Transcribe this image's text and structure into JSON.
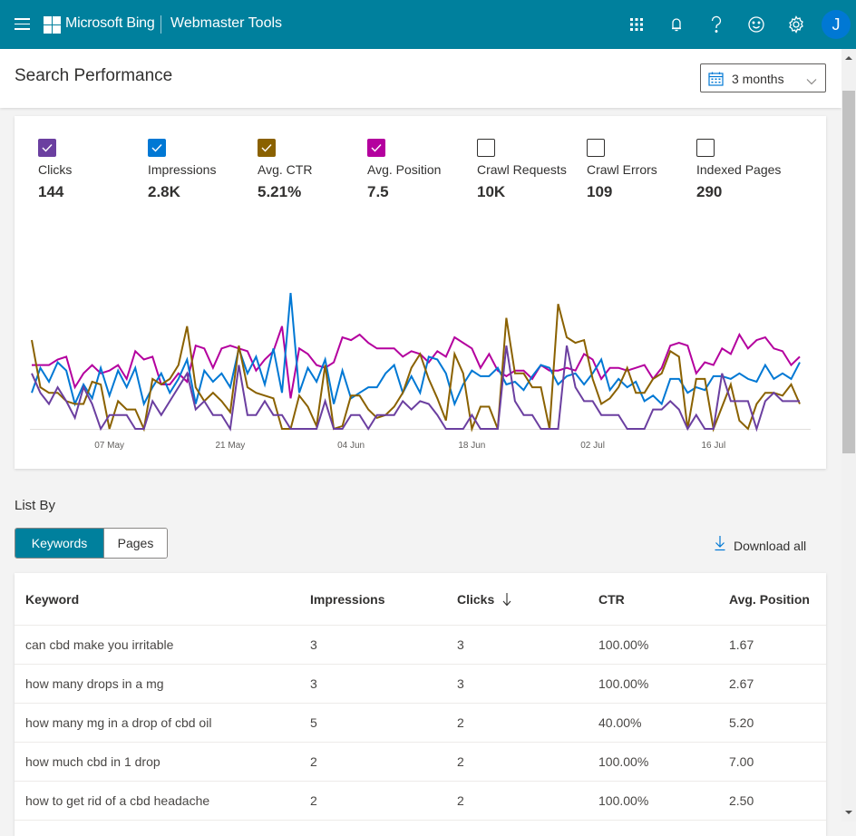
{
  "topbar": {
    "brand": "Microsoft Bing",
    "product": "Webmaster Tools",
    "avatar_initial": "J",
    "icons": [
      "menu-icon",
      "microsoft-logo-icon",
      "app-launcher-icon",
      "bell-icon",
      "help-icon",
      "feedback-smiley-icon",
      "settings-gear-icon"
    ],
    "bg_color": "#00809d"
  },
  "header": {
    "title": "Search Performance",
    "date_range": "3 months"
  },
  "metrics": [
    {
      "label": "Clicks",
      "value": "144",
      "checked": true,
      "color": "#6b3fa0"
    },
    {
      "label": "Impressions",
      "value": "2.8K",
      "checked": true,
      "color": "#0078d4"
    },
    {
      "label": "Avg. CTR",
      "value": "5.21%",
      "checked": true,
      "color": "#8a6100"
    },
    {
      "label": "Avg. Position",
      "value": "7.5",
      "checked": true,
      "color": "#b4009e"
    },
    {
      "label": "Crawl Requests",
      "value": "10K",
      "checked": false,
      "color": "#323130"
    },
    {
      "label": "Crawl Errors",
      "value": "109",
      "checked": false,
      "color": "#323130"
    },
    {
      "label": "Indexed Pages",
      "value": "290",
      "checked": false,
      "color": "#323130"
    }
  ],
  "chart_data": {
    "type": "line",
    "title": "",
    "xlabel": "",
    "ylabel": "",
    "x_start": "28 Apr",
    "x_end": "26 Jul",
    "x_tick_labels": [
      "07 May",
      "21 May",
      "04 Jun",
      "18 Jun",
      "02 Jul",
      "16 Jul"
    ],
    "x_tick_indices": [
      9,
      23,
      37,
      51,
      65,
      79
    ],
    "ylim": [
      0,
      100
    ],
    "y_units": "normalized (each series scaled independently, no y-axis shown)",
    "grid": false,
    "legend": "none (metric checkboxes above)",
    "series": [
      {
        "name": "Avg. Position",
        "color": "#b4009e",
        "values": [
          46,
          46,
          46,
          50,
          52,
          30,
          40,
          46,
          40,
          42,
          46,
          36,
          56,
          50,
          52,
          32,
          32,
          40,
          34,
          60,
          58,
          44,
          58,
          60,
          58,
          56,
          42,
          50,
          56,
          74,
          22,
          58,
          54,
          46,
          44,
          48,
          66,
          64,
          68,
          62,
          58,
          58,
          58,
          52,
          56,
          54,
          48,
          56,
          52,
          66,
          62,
          58,
          44,
          54,
          42,
          38,
          42,
          42,
          36,
          46,
          42,
          42,
          44,
          42,
          54,
          50,
          36,
          44,
          44,
          42,
          44,
          46,
          36,
          44,
          60,
          62,
          60,
          40,
          48,
          46,
          58,
          54,
          68,
          58,
          64,
          66,
          58,
          56,
          46,
          52
        ]
      },
      {
        "name": "Impressions",
        "color": "#0078d4",
        "values": [
          26,
          44,
          34,
          48,
          42,
          18,
          32,
          22,
          44,
          24,
          42,
          30,
          44,
          18,
          30,
          40,
          26,
          36,
          50,
          18,
          42,
          34,
          40,
          30,
          58,
          40,
          52,
          32,
          58,
          26,
          98,
          26,
          44,
          34,
          50,
          18,
          42,
          22,
          26,
          30,
          30,
          40,
          46,
          26,
          38,
          26,
          52,
          50,
          40,
          18,
          32,
          42,
          38,
          38,
          44,
          32,
          34,
          28,
          38,
          46,
          44,
          32,
          38,
          40,
          32,
          40,
          50,
          28,
          36,
          30,
          34,
          20,
          24,
          18,
          36,
          36,
          26,
          30,
          28,
          38,
          38,
          36,
          40,
          36,
          34,
          46,
          36,
          40,
          36,
          48
        ]
      },
      {
        "name": "Avg. CTR",
        "color": "#8a6100",
        "values": [
          64,
          30,
          26,
          26,
          20,
          18,
          18,
          34,
          32,
          0,
          20,
          14,
          14,
          0,
          36,
          32,
          36,
          46,
          74,
          30,
          20,
          26,
          20,
          12,
          60,
          30,
          26,
          24,
          22,
          0,
          0,
          24,
          16,
          2,
          46,
          0,
          2,
          24,
          24,
          14,
          8,
          10,
          16,
          26,
          44,
          54,
          36,
          22,
          6,
          54,
          40,
          0,
          16,
          16,
          0,
          80,
          40,
          40,
          30,
          30,
          0,
          90,
          66,
          62,
          64,
          36,
          18,
          22,
          30,
          44,
          26,
          26,
          36,
          40,
          56,
          52,
          0,
          36,
          36,
          0,
          16,
          32,
          6,
          0,
          18,
          26,
          26,
          24,
          32,
          18
        ]
      },
      {
        "name": "Clicks",
        "color": "#6b3fa0",
        "values": [
          40,
          26,
          18,
          30,
          20,
          8,
          30,
          18,
          0,
          10,
          10,
          10,
          0,
          0,
          20,
          10,
          20,
          30,
          40,
          14,
          20,
          10,
          10,
          0,
          46,
          10,
          10,
          20,
          10,
          10,
          0,
          0,
          0,
          0,
          20,
          0,
          0,
          10,
          10,
          0,
          10,
          10,
          10,
          20,
          14,
          20,
          18,
          10,
          0,
          0,
          0,
          10,
          0,
          0,
          0,
          60,
          20,
          10,
          10,
          0,
          0,
          0,
          60,
          30,
          20,
          20,
          10,
          10,
          10,
          0,
          0,
          0,
          14,
          14,
          20,
          14,
          0,
          10,
          0,
          0,
          40,
          20,
          20,
          20,
          0,
          20,
          26,
          20,
          20,
          20
        ]
      }
    ]
  },
  "list": {
    "label": "List By",
    "tabs": [
      {
        "label": "Keywords",
        "active": true
      },
      {
        "label": "Pages",
        "active": false
      }
    ],
    "download_label": "Download all",
    "columns": [
      "Keyword",
      "Impressions",
      "Clicks",
      "CTR",
      "Avg. Position"
    ],
    "sorted_column": "Clicks",
    "sort_direction": "descending",
    "rows": [
      [
        "can cbd make you irritable",
        "3",
        "3",
        "100.00%",
        "1.67"
      ],
      [
        "how many drops in a mg",
        "3",
        "3",
        "100.00%",
        "2.67"
      ],
      [
        "how many mg in a drop of cbd oil",
        "5",
        "2",
        "40.00%",
        "5.20"
      ],
      [
        "how much cbd in 1 drop",
        "2",
        "2",
        "100.00%",
        "7.00"
      ],
      [
        "how to get rid of a cbd headache",
        "2",
        "2",
        "100.00%",
        "2.50"
      ]
    ]
  }
}
